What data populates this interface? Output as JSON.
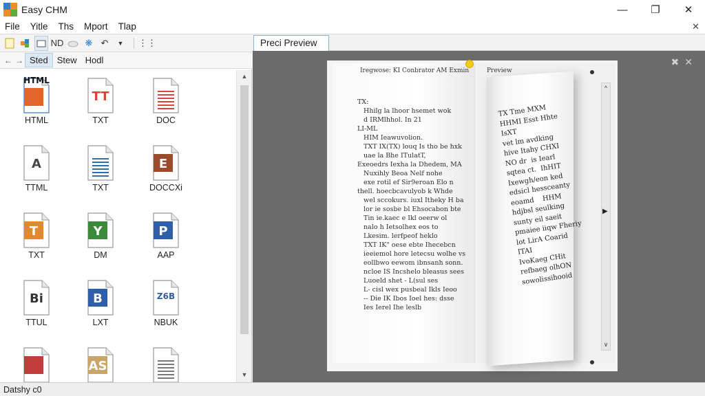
{
  "window": {
    "title": "Easy CHM"
  },
  "menu": {
    "items": [
      "File",
      "Yitle",
      "Ths",
      "Mport",
      "Tlap"
    ]
  },
  "toolbar": {
    "nd_label": "ND"
  },
  "nav": {
    "tabs": [
      "Sted",
      "Stew",
      "Hodl"
    ]
  },
  "files": [
    {
      "label": "HTML",
      "badge": "HTML",
      "kind": "html",
      "color": "#e0662a"
    },
    {
      "label": "TXT",
      "badge": "TT",
      "kind": "txt",
      "color": "#d8443a"
    },
    {
      "label": "DOC",
      "badge": "",
      "kind": "doc",
      "color": "#d8443a"
    },
    {
      "label": "TTML",
      "badge": "A",
      "kind": "outline",
      "color": "#444444"
    },
    {
      "label": "TXT",
      "badge": "",
      "kind": "lines",
      "color": "#2e6db4"
    },
    {
      "label": "DOCCXi",
      "badge": "E",
      "kind": "solid",
      "color": "#9c4a2c"
    },
    {
      "label": "TXT",
      "badge": "T",
      "kind": "solid",
      "color": "#e08a2c"
    },
    {
      "label": "DM",
      "badge": "Y",
      "kind": "solid",
      "color": "#3a8a3a"
    },
    {
      "label": "AAP",
      "badge": "P",
      "kind": "solid",
      "color": "#2f5fa8"
    },
    {
      "label": "TTUL",
      "badge": "Bi",
      "kind": "outline",
      "color": "#333333"
    },
    {
      "label": "LXT",
      "badge": "B",
      "kind": "solid",
      "color": "#2f5fa8"
    },
    {
      "label": "NBUK",
      "badge": "Z6B",
      "kind": "outline",
      "color": "#2f5fa8"
    },
    {
      "label": "",
      "badge": "",
      "kind": "solid",
      "color": "#c23b3b"
    },
    {
      "label": "",
      "badge": "AS",
      "kind": "solid",
      "color": "#c9a56a"
    },
    {
      "label": "",
      "badge": "",
      "kind": "lines",
      "color": "#777777"
    }
  ],
  "preview": {
    "tab_label": "Preci Preview",
    "header": "Iregwose: KI    Conbrator AM Exmin",
    "preview_label": "Preview",
    "left_page_text": "TX:\n   Hhilg la lhoor hsemet wok\n   d IRMlhhol. In 21\nLI-ML\n   HIM Ieawuvolion.\n   TXT IX(TX) louq Is tho be hxk\n   uae la Bhe ITulatT,\nExeoedrs Iexha la Dhedem, MA\n   Nuxihly Beoa Nelf nohe\n   exe rotil ef Sir9eroan Elo n\nthell. hoecbcavulyob k Whde\n   wel sccokurs. iuxl Itheky H ba\n   lor ie sosbe bl Ehsocabon bte\n   Tin ie.kaec e Ikl oeerw ol\n   nalo h Ietsolhex eos to\n   Lkesim. lerfpeof heklo\n   TXT IK\" oese ebte Ihecebcn\n   ieeiemol hore letecsu wolhe vs\n   eollbwo eewom ibnsanh sonn.\n   ncloe IS Incshelo bleasus sees\n   Luoeld shet - L(sul ses\n   L- cisl wex pusbeal Ikls Ieoo\n   -- Die IK Ibos Ioel hes: dsse\n   Ies Ierel Ihe leslb",
    "flip_page_text": "TX Tme MXM\nHHMI Esst Hhte\nIsXT\nvet lm avdking\nhive Itahy CHXI\nNO dr  is Iearl\nsqtea ct.  IhHIT\nIxewgh/eon ked\nedsicl hessceanty\neoamd    HHM\nhdjbsl seulking\nsunty eil saeit\npmaiee iiqw Fheriy\nlot LirA Coarid\nITAI\nIvoKaeg CHit\nrefbaeg olhON\nsowolissihooid"
  },
  "status": {
    "text": "Datshy c0"
  },
  "colors": {
    "accent": "#8fb0d6",
    "preview_bg": "#6b6b6b"
  }
}
